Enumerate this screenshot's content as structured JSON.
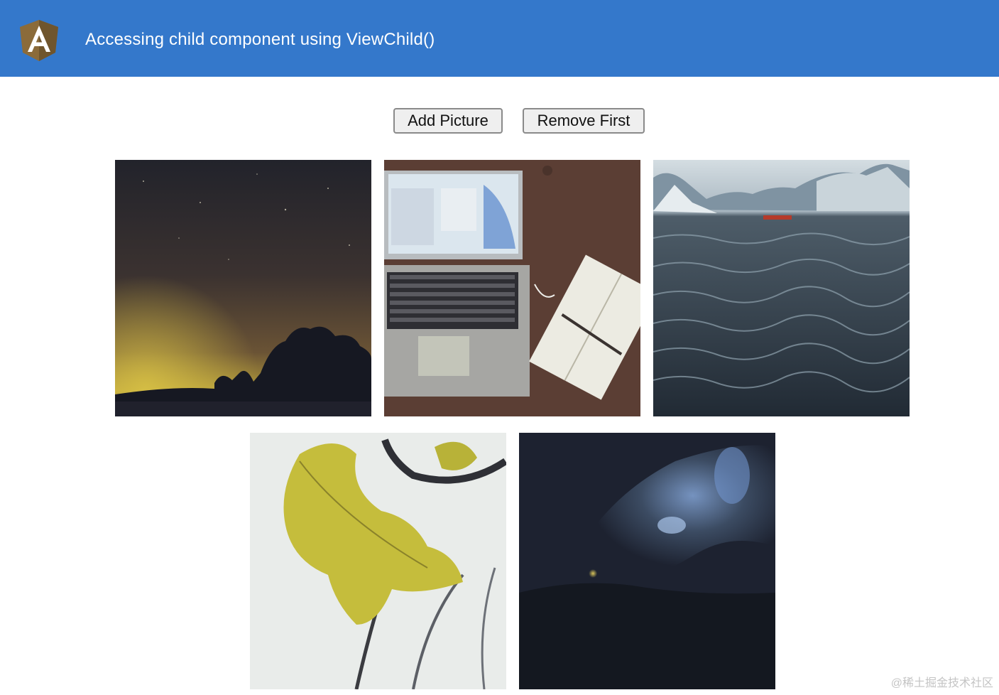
{
  "toolbar": {
    "title": "Accessing child component using ViewChild()",
    "logo_icon": "angular-logo-icon",
    "background_color": "#3478cb"
  },
  "actions": {
    "add_label": "Add Picture",
    "remove_label": "Remove First"
  },
  "pictures": [
    {
      "subject": "night sky over tree silhouettes"
    },
    {
      "subject": "laptop and notebook on desk"
    },
    {
      "subject": "mountain lake with boat"
    },
    {
      "subject": "yellow autumn leaf"
    },
    {
      "subject": "aurora over dark landscape"
    }
  ],
  "watermark": "@稀土掘金技术社区"
}
